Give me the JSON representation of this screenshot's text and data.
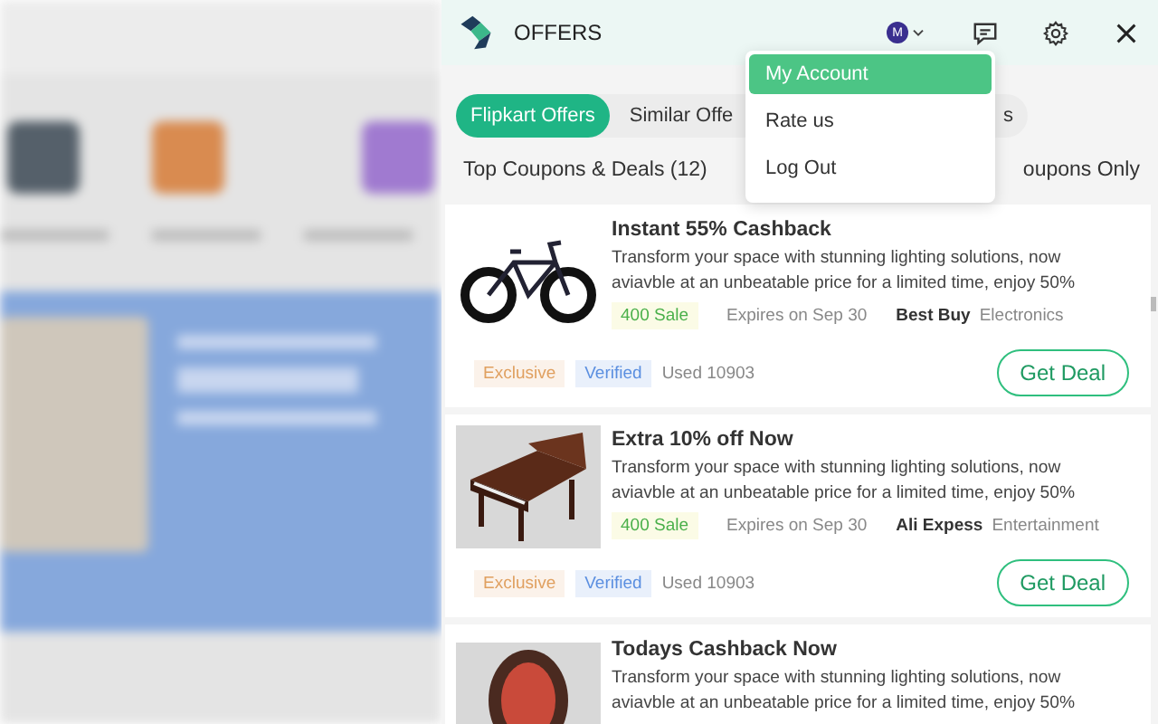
{
  "header": {
    "title": "OFFERS",
    "avatar_letter": "M"
  },
  "menu": [
    {
      "label": "My Account",
      "selected": true
    },
    {
      "label": "Rate us",
      "selected": false
    },
    {
      "label": "Log Out",
      "selected": false
    }
  ],
  "tabs": [
    {
      "label": "Flipkart Offers",
      "selected": true
    },
    {
      "label": "Similar Offe",
      "selected": false
    },
    {
      "label": "s",
      "selected": false
    }
  ],
  "list_heading": "Top Coupons & Deals (12)",
  "filter_label": "oupons Only",
  "offers": [
    {
      "kind": "bicycle",
      "title": "Instant 55% Cashback",
      "description": "Transform your space with stunning lighting solutions, now aviavble at an unbeatable price for a limited time, enjoy 50%",
      "sales": "400 Sale",
      "expiry": "Expires on Sep 30",
      "store": "Best Buy",
      "category": "Electronics",
      "tags": [
        {
          "label": "Exclusive",
          "color": "#e0a060"
        },
        {
          "label": "Verified",
          "color": "#5b8fe0"
        }
      ],
      "used": "Used 10903",
      "button": "Get Deal"
    },
    {
      "kind": "piano",
      "title": "Extra 10% off Now",
      "description": "Transform your space with stunning lighting solutions, now aviavble at an unbeatable price for a limited time, enjoy 50%",
      "sales": "400 Sale",
      "expiry": "Expires on Sep 30",
      "store": "Ali Expess",
      "category": "Entertainment",
      "tags": [
        {
          "label": "Exclusive",
          "color": "#e0a060"
        },
        {
          "label": "Verified",
          "color": "#5b8fe0"
        }
      ],
      "used": "Used 10903",
      "button": "Get Deal"
    },
    {
      "kind": "chair",
      "title": "Todays Cashback Now",
      "description": "Transform your space with stunning lighting solutions, now aviavble at an unbeatable price for a limited time, enjoy 50%"
    }
  ]
}
